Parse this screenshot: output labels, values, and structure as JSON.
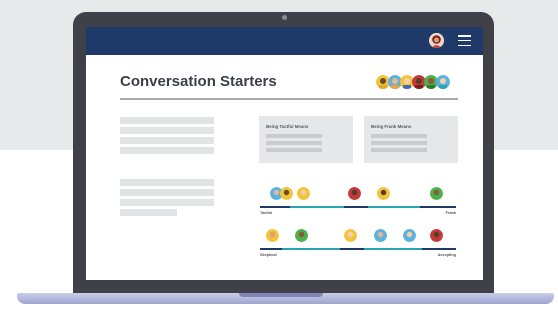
{
  "header": {
    "menu_icon": "hamburger-menu-icon",
    "user_avatar_icon": "user-avatar-icon",
    "colors": {
      "bar": "#1f3a68"
    }
  },
  "main": {
    "title": "Conversation Starters",
    "avatar_group_count": 6
  },
  "cards": [
    {
      "title": "Being Tactful Means"
    },
    {
      "title": "Being Frank Means"
    }
  ],
  "scales": [
    {
      "left_label": "Tactful",
      "right_label": "Frank"
    },
    {
      "left_label": "Skeptical",
      "right_label": "Accepting"
    }
  ]
}
